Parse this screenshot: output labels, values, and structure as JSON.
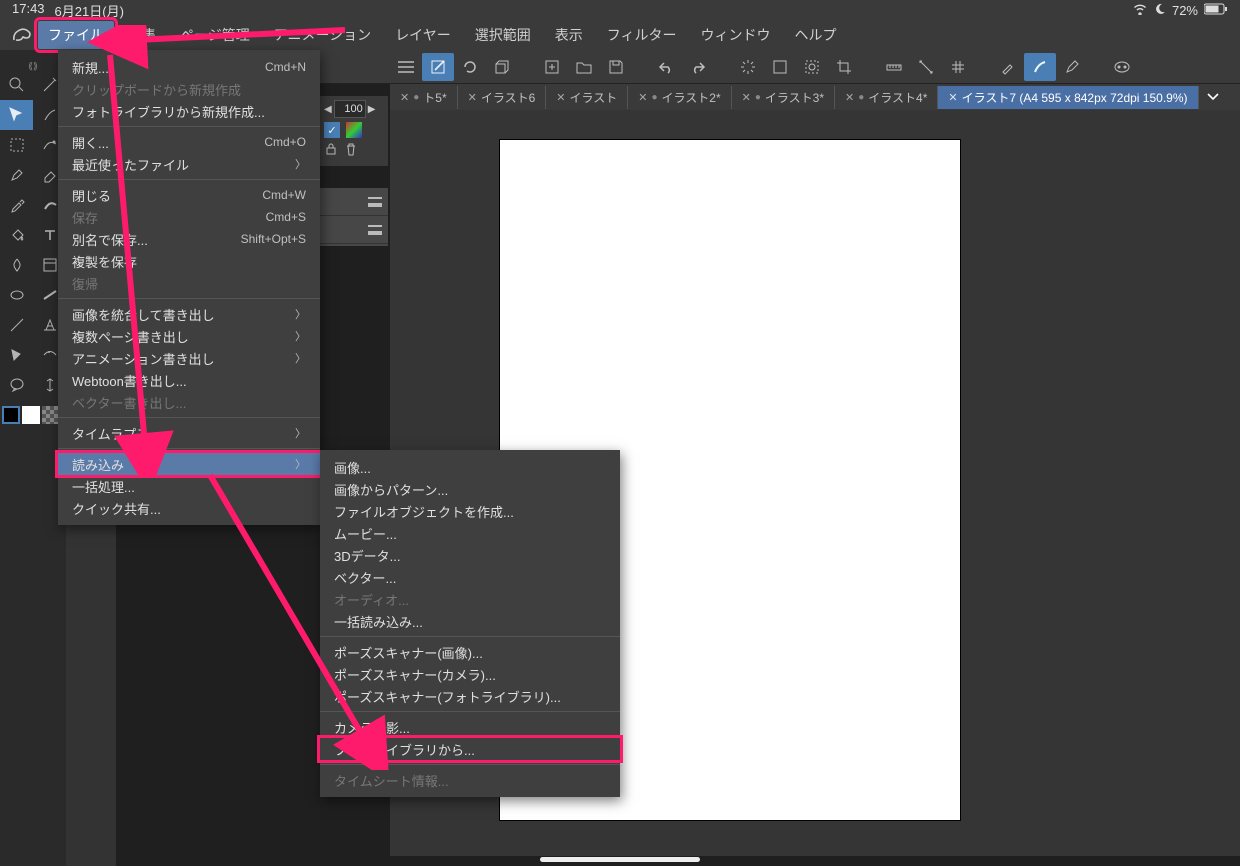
{
  "status": {
    "time": "17:43",
    "date": "6月21日(月)",
    "battery": "72%"
  },
  "menubar": {
    "items": [
      "ファイル",
      "編集",
      "ページ管理",
      "アニメーション",
      "レイヤー",
      "選択範囲",
      "表示",
      "フィルター",
      "ウィンドウ",
      "ヘルプ"
    ],
    "active_index": 0
  },
  "tabs": {
    "items": [
      {
        "label": "ト5*",
        "dirty": true
      },
      {
        "label": "イラスト6"
      },
      {
        "label": "イラスト"
      },
      {
        "label": "イラスト2*",
        "dirty": true
      },
      {
        "label": "イラスト3*",
        "dirty": true
      },
      {
        "label": "イラスト4*",
        "dirty": true
      },
      {
        "label": "イラスト7 (A4 595 x 842px 72dpi 150.9%)",
        "active": true
      }
    ]
  },
  "opacity_value": "100",
  "file_menu": [
    {
      "label": "新規...",
      "shortcut": "Cmd+N"
    },
    {
      "label": "クリップボードから新規作成",
      "disabled": true
    },
    {
      "label": "フォトライブラリから新規作成..."
    },
    {
      "sep": true
    },
    {
      "label": "開く...",
      "shortcut": "Cmd+O"
    },
    {
      "label": "最近使ったファイル",
      "submenu": true
    },
    {
      "sep": true
    },
    {
      "label": "閉じる",
      "shortcut": "Cmd+W"
    },
    {
      "label": "保存",
      "shortcut": "Cmd+S",
      "disabled": true
    },
    {
      "label": "別名で保存...",
      "shortcut": "Shift+Opt+S"
    },
    {
      "label": "複製を保存"
    },
    {
      "label": "復帰",
      "disabled": true
    },
    {
      "sep": true
    },
    {
      "label": "画像を統合して書き出し",
      "submenu": true
    },
    {
      "label": "複数ページ書き出し",
      "submenu": true
    },
    {
      "label": "アニメーション書き出し",
      "submenu": true
    },
    {
      "label": "Webtoon書き出し..."
    },
    {
      "label": "ベクター書き出し...",
      "disabled": true
    },
    {
      "sep": true
    },
    {
      "label": "タイムラプス",
      "submenu": true
    },
    {
      "sep": true
    },
    {
      "label": "読み込み",
      "submenu": true,
      "highlighted": true,
      "box": true
    },
    {
      "label": "一括処理..."
    },
    {
      "label": "クイック共有..."
    }
  ],
  "import_submenu": [
    {
      "label": "画像..."
    },
    {
      "label": "画像からパターン..."
    },
    {
      "label": "ファイルオブジェクトを作成..."
    },
    {
      "label": "ムービー..."
    },
    {
      "label": "3Dデータ..."
    },
    {
      "label": "ベクター..."
    },
    {
      "label": "オーディオ...",
      "disabled": true
    },
    {
      "label": "一括読み込み..."
    },
    {
      "sep": true
    },
    {
      "label": "ポーズスキャナー(画像)..."
    },
    {
      "label": "ポーズスキャナー(カメラ)..."
    },
    {
      "label": "ポーズスキャナー(フォトライブラリ)..."
    },
    {
      "sep": true
    },
    {
      "label": "カメラ撮影..."
    },
    {
      "label": "フォトライブラリから...",
      "box": true
    },
    {
      "sep": true
    },
    {
      "label": "タイムシート情報...",
      "disabled": true
    }
  ]
}
